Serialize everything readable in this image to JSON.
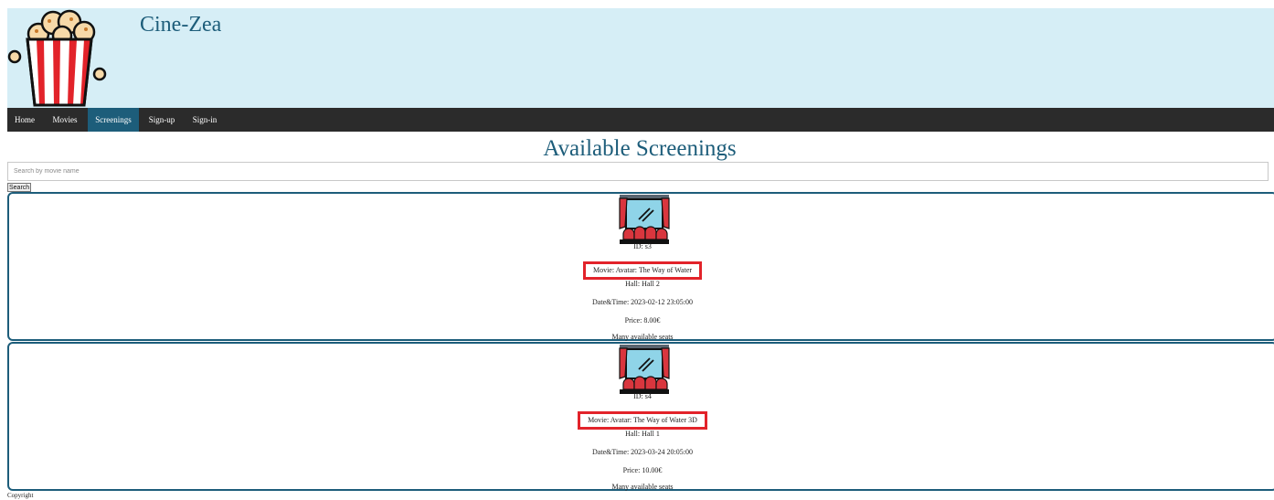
{
  "site": {
    "title": "Cine-Zea"
  },
  "nav": {
    "items": [
      {
        "label": "Home",
        "active": false
      },
      {
        "label": "Movies",
        "active": false
      },
      {
        "label": "Screenings",
        "active": true
      },
      {
        "label": "Sign-up",
        "active": false
      },
      {
        "label": "Sign-in",
        "active": false
      }
    ]
  },
  "main": {
    "heading": "Available Screenings",
    "search": {
      "placeholder": "Search by movie name",
      "value": "",
      "button_label": "Search"
    },
    "screenings": [
      {
        "id": "ID: s3",
        "movie": "Movie: Avatar: The Way of Water",
        "hall": "Hall: Hall 2",
        "datetime": "Date&Time: 2023-02-12 23:05:00",
        "price": "Price: 8.00€",
        "availability": "Many available seats"
      },
      {
        "id": "ID: s4",
        "movie": "Movie: Avatar: The Way of Water 3D",
        "hall": "Hall: Hall 1",
        "datetime": "Date&Time: 2023-03-24 20:05:00",
        "price": "Price: 10.00€",
        "availability": "Many available seats"
      }
    ]
  },
  "footer": {
    "text": "Copyright"
  },
  "colors": {
    "header_bg": "#d6eef6",
    "nav_bg": "#2b2b2b",
    "nav_active_bg": "#1d5d7a",
    "accent": "#1d5d7a",
    "highlight": "#e2232a"
  }
}
